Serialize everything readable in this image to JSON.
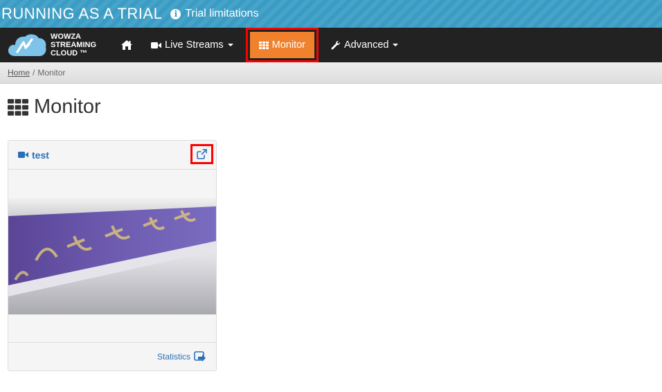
{
  "banner": {
    "title": "RUNNING AS A TRIAL",
    "link_label": "Trial limitations"
  },
  "brand": {
    "name": "WOWZA\nSTREAMING\nCLOUD ™"
  },
  "nav": {
    "live_streams_label": "Live Streams",
    "monitor_label": "Monitor",
    "advanced_label": "Advanced"
  },
  "breadcrumb": {
    "home": "Home",
    "separator": "/",
    "current": "Monitor"
  },
  "page": {
    "title": "Monitor"
  },
  "stream_card": {
    "name": "test",
    "footer_link": "Statistics"
  },
  "colors": {
    "banner_bg": "#3a9cc4",
    "navbar_bg": "#222222",
    "active_nav": "#f0812d",
    "link": "#2a6ebb",
    "highlight_box": "#ff0000"
  }
}
